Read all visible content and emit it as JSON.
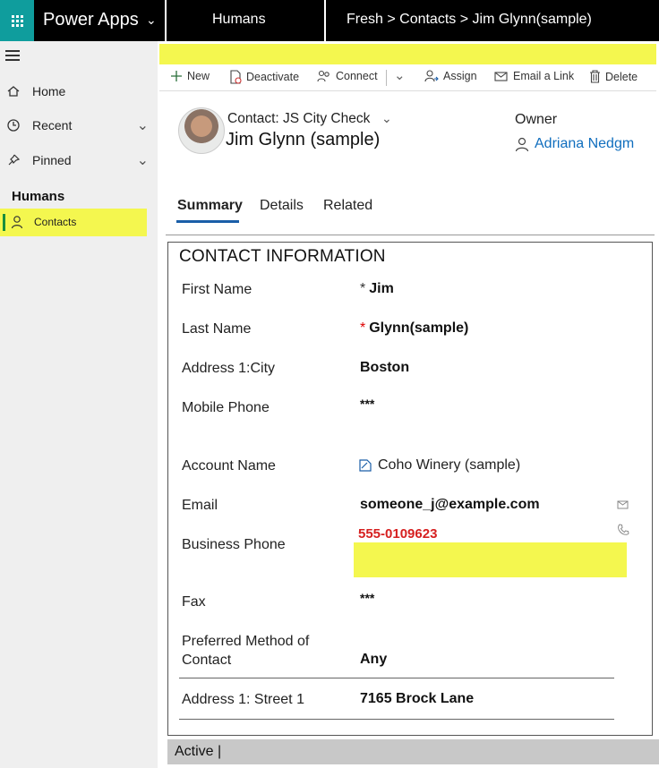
{
  "topbar": {
    "app_title": "Power Apps",
    "environment": "Humans",
    "breadcrumb": "Fresh > Contacts > Jim Glynn(sample)",
    "accent_color": "#0f9d9d"
  },
  "sidebar": {
    "items": [
      {
        "label": "Home",
        "icon": "home-icon"
      },
      {
        "label": "Recent",
        "icon": "clock-icon"
      },
      {
        "label": "Pinned",
        "icon": "pin-icon"
      }
    ],
    "group_title": "Humans",
    "active_item": {
      "label": "Contacts",
      "icon": "person-icon"
    }
  },
  "commands": [
    {
      "label": "New",
      "icon": "plus-icon"
    },
    {
      "label": "Deactivate",
      "icon": "deactivate-icon"
    },
    {
      "label": "Connect",
      "icon": "connect-icon"
    },
    {
      "label": "Assign",
      "icon": "assign-icon"
    },
    {
      "label": "Email a Link",
      "icon": "email-link-icon"
    },
    {
      "label": "Delete",
      "icon": "trash-icon"
    }
  ],
  "header": {
    "form_name": "Contact: JS City Check",
    "record_title": "Jim Glynn (sample)",
    "owner_label": "Owner",
    "owner_value": "Adriana Nedgm"
  },
  "tabs": [
    {
      "label": "Summary",
      "active": true
    },
    {
      "label": "Details",
      "active": false
    },
    {
      "label": "Related",
      "active": false
    }
  ],
  "section": {
    "title": "CONTACT INFORMATION",
    "fields": {
      "first_name": {
        "label": "First Name",
        "required_mark": "*",
        "value": "Jim"
      },
      "last_name": {
        "label": "Last Name",
        "required_mark": "*",
        "value": "Glynn(sample)"
      },
      "city": {
        "label": "Address 1:City",
        "value": "Boston"
      },
      "mobile": {
        "label": "Mobile Phone",
        "value": "***"
      },
      "account": {
        "label": "Account Name",
        "value": "Coho Winery (sample)"
      },
      "email": {
        "label": "Email",
        "value": "someone_j@example.com"
      },
      "business_phone": {
        "label": "Business Phone",
        "value": "555-0109623"
      },
      "fax": {
        "label": "Fax",
        "value": "***"
      },
      "preferred_contact": {
        "label_line1": "Preferred Method of",
        "label_line2": "Contact",
        "value": "Any"
      },
      "street": {
        "label": "Address 1: Street 1",
        "value": "7165 Brock Lane"
      }
    }
  },
  "status": {
    "text": "Active |"
  },
  "colors": {
    "highlight": "#f4f74f",
    "link": "#106ebe",
    "error_red": "#d62020"
  }
}
